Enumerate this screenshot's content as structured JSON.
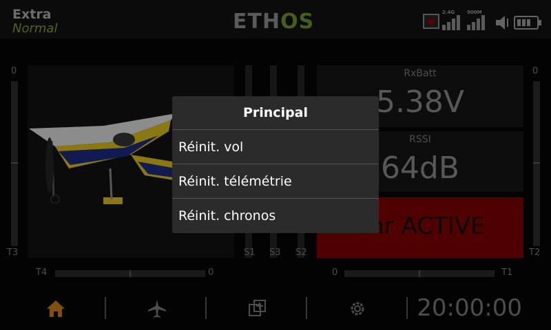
{
  "header": {
    "model_name": "Extra",
    "flight_mode": "Normal",
    "logo_left": "ETH",
    "logo_right": "OS",
    "signal_24g_label": "2.4G",
    "signal_900m_label": "900M"
  },
  "trims": {
    "left_top": "0",
    "right_top": "0",
    "t3": "T3",
    "t2": "T2",
    "t4": "T4",
    "t4_value": "0",
    "t1": "T1",
    "t1_value": "0",
    "s1": "S1",
    "s3": "S3",
    "s2": "S2"
  },
  "widgets": {
    "rxbatt_title": "RxBatt",
    "rxbatt_value": "5.38V",
    "rssi_title": "RSSI",
    "rssi_value": "64dB",
    "alert_text": "Thr ACTIVE"
  },
  "footer": {
    "clock": "20:00:00",
    "icons": [
      "home-icon",
      "airplane-icon",
      "model-setup-icon",
      "gear-icon"
    ]
  },
  "menu": {
    "title": "Principal",
    "items": [
      {
        "label": "Réinit. vol"
      },
      {
        "label": "Réinit. télémétrie"
      },
      {
        "label": "Réinit. chronos"
      }
    ]
  },
  "colors": {
    "accent_green": "#6c8f2a",
    "home_icon": "#c87a1e",
    "alert_red": "#7a0000"
  }
}
